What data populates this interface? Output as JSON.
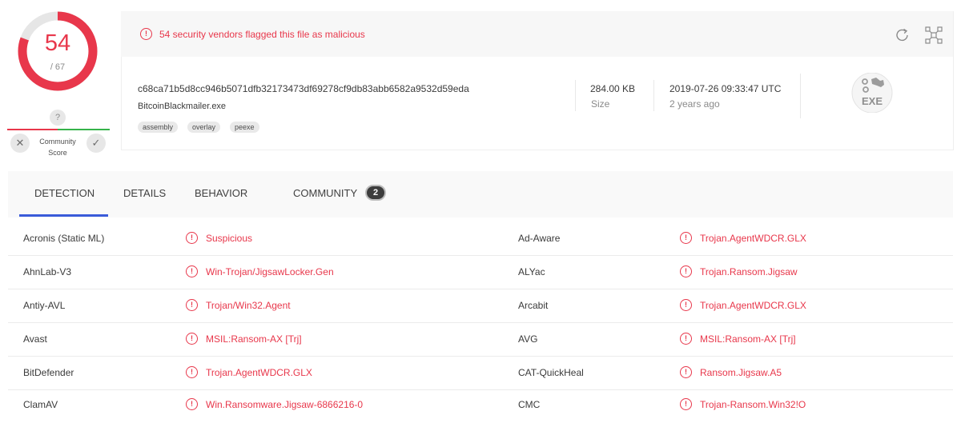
{
  "score": {
    "detections": "54",
    "total": "/ 67",
    "detection_ratio": 0.806
  },
  "community": {
    "question": "?",
    "label_line1": "Community",
    "label_line2": "Score",
    "downvote": "✕",
    "upvote": "✓"
  },
  "alert": {
    "icon": "!",
    "text": "54 security vendors flagged this file as malicious"
  },
  "file": {
    "hash": "c68ca71b5d8cc946b5071dfb32173473df69278cf9db83abb6582a9532d59eda",
    "name": "BitcoinBlackmailer.exe",
    "tags": [
      "assembly",
      "overlay",
      "peexe"
    ],
    "size": "284.00 KB",
    "size_label": "Size",
    "date": "2019-07-26 09:33:47 UTC",
    "date_ago": "2 years ago",
    "type": "EXE"
  },
  "tabs": [
    {
      "label": "DETECTION"
    },
    {
      "label": "DETAILS"
    },
    {
      "label": "BEHAVIOR"
    },
    {
      "label": "COMMUNITY",
      "badge": "2"
    }
  ],
  "detections": [
    {
      "left_engine": "Acronis (Static ML)",
      "left_result": "Suspicious",
      "right_engine": "Ad-Aware",
      "right_result": "Trojan.AgentWDCR.GLX"
    },
    {
      "left_engine": "AhnLab-V3",
      "left_result": "Win-Trojan/JigsawLocker.Gen",
      "right_engine": "ALYac",
      "right_result": "Trojan.Ransom.Jigsaw"
    },
    {
      "left_engine": "Antiy-AVL",
      "left_result": "Trojan/Win32.Agent",
      "right_engine": "Arcabit",
      "right_result": "Trojan.AgentWDCR.GLX"
    },
    {
      "left_engine": "Avast",
      "left_result": "MSIL:Ransom-AX [Trj]",
      "right_engine": "AVG",
      "right_result": "MSIL:Ransom-AX [Trj]"
    },
    {
      "left_engine": "BitDefender",
      "left_result": "Trojan.AgentWDCR.GLX",
      "right_engine": "CAT-QuickHeal",
      "right_result": "Ransom.Jigsaw.A5"
    },
    {
      "left_engine": "ClamAV",
      "left_result": "Win.Ransomware.Jigsaw-6866216-0",
      "right_engine": "CMC",
      "right_result": "Trojan-Ransom.Win32!O"
    }
  ],
  "colors": {
    "malicious": "#e8374b",
    "accent": "#3a5bd9",
    "harmless": "#35b34a"
  },
  "icons": [
    "alert-circle-icon",
    "reanalyze-icon",
    "similar-icon",
    "exe-file-icon",
    "close-icon",
    "check-icon"
  ]
}
